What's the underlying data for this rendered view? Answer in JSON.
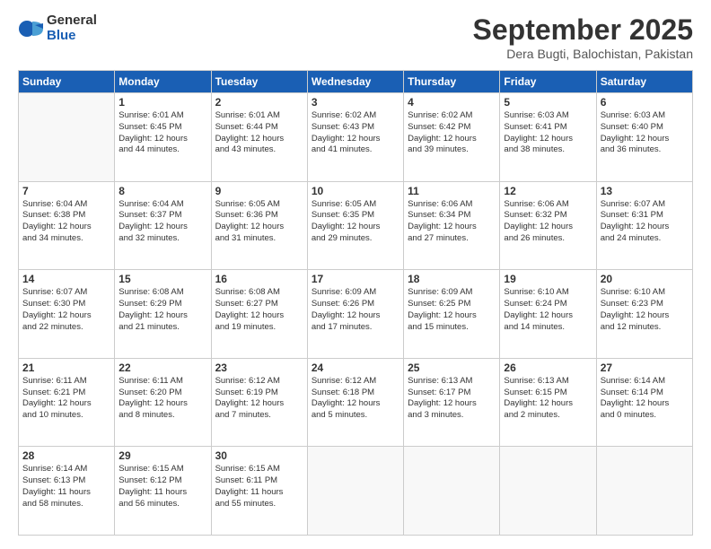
{
  "logo": {
    "general": "General",
    "blue": "Blue"
  },
  "header": {
    "title": "September 2025",
    "location": "Dera Bugti, Balochistan, Pakistan"
  },
  "weekdays": [
    "Sunday",
    "Monday",
    "Tuesday",
    "Wednesday",
    "Thursday",
    "Friday",
    "Saturday"
  ],
  "weeks": [
    [
      {
        "day": "",
        "info": ""
      },
      {
        "day": "1",
        "info": "Sunrise: 6:01 AM\nSunset: 6:45 PM\nDaylight: 12 hours\nand 44 minutes."
      },
      {
        "day": "2",
        "info": "Sunrise: 6:01 AM\nSunset: 6:44 PM\nDaylight: 12 hours\nand 43 minutes."
      },
      {
        "day": "3",
        "info": "Sunrise: 6:02 AM\nSunset: 6:43 PM\nDaylight: 12 hours\nand 41 minutes."
      },
      {
        "day": "4",
        "info": "Sunrise: 6:02 AM\nSunset: 6:42 PM\nDaylight: 12 hours\nand 39 minutes."
      },
      {
        "day": "5",
        "info": "Sunrise: 6:03 AM\nSunset: 6:41 PM\nDaylight: 12 hours\nand 38 minutes."
      },
      {
        "day": "6",
        "info": "Sunrise: 6:03 AM\nSunset: 6:40 PM\nDaylight: 12 hours\nand 36 minutes."
      }
    ],
    [
      {
        "day": "7",
        "info": "Sunrise: 6:04 AM\nSunset: 6:38 PM\nDaylight: 12 hours\nand 34 minutes."
      },
      {
        "day": "8",
        "info": "Sunrise: 6:04 AM\nSunset: 6:37 PM\nDaylight: 12 hours\nand 32 minutes."
      },
      {
        "day": "9",
        "info": "Sunrise: 6:05 AM\nSunset: 6:36 PM\nDaylight: 12 hours\nand 31 minutes."
      },
      {
        "day": "10",
        "info": "Sunrise: 6:05 AM\nSunset: 6:35 PM\nDaylight: 12 hours\nand 29 minutes."
      },
      {
        "day": "11",
        "info": "Sunrise: 6:06 AM\nSunset: 6:34 PM\nDaylight: 12 hours\nand 27 minutes."
      },
      {
        "day": "12",
        "info": "Sunrise: 6:06 AM\nSunset: 6:32 PM\nDaylight: 12 hours\nand 26 minutes."
      },
      {
        "day": "13",
        "info": "Sunrise: 6:07 AM\nSunset: 6:31 PM\nDaylight: 12 hours\nand 24 minutes."
      }
    ],
    [
      {
        "day": "14",
        "info": "Sunrise: 6:07 AM\nSunset: 6:30 PM\nDaylight: 12 hours\nand 22 minutes."
      },
      {
        "day": "15",
        "info": "Sunrise: 6:08 AM\nSunset: 6:29 PM\nDaylight: 12 hours\nand 21 minutes."
      },
      {
        "day": "16",
        "info": "Sunrise: 6:08 AM\nSunset: 6:27 PM\nDaylight: 12 hours\nand 19 minutes."
      },
      {
        "day": "17",
        "info": "Sunrise: 6:09 AM\nSunset: 6:26 PM\nDaylight: 12 hours\nand 17 minutes."
      },
      {
        "day": "18",
        "info": "Sunrise: 6:09 AM\nSunset: 6:25 PM\nDaylight: 12 hours\nand 15 minutes."
      },
      {
        "day": "19",
        "info": "Sunrise: 6:10 AM\nSunset: 6:24 PM\nDaylight: 12 hours\nand 14 minutes."
      },
      {
        "day": "20",
        "info": "Sunrise: 6:10 AM\nSunset: 6:23 PM\nDaylight: 12 hours\nand 12 minutes."
      }
    ],
    [
      {
        "day": "21",
        "info": "Sunrise: 6:11 AM\nSunset: 6:21 PM\nDaylight: 12 hours\nand 10 minutes."
      },
      {
        "day": "22",
        "info": "Sunrise: 6:11 AM\nSunset: 6:20 PM\nDaylight: 12 hours\nand 8 minutes."
      },
      {
        "day": "23",
        "info": "Sunrise: 6:12 AM\nSunset: 6:19 PM\nDaylight: 12 hours\nand 7 minutes."
      },
      {
        "day": "24",
        "info": "Sunrise: 6:12 AM\nSunset: 6:18 PM\nDaylight: 12 hours\nand 5 minutes."
      },
      {
        "day": "25",
        "info": "Sunrise: 6:13 AM\nSunset: 6:17 PM\nDaylight: 12 hours\nand 3 minutes."
      },
      {
        "day": "26",
        "info": "Sunrise: 6:13 AM\nSunset: 6:15 PM\nDaylight: 12 hours\nand 2 minutes."
      },
      {
        "day": "27",
        "info": "Sunrise: 6:14 AM\nSunset: 6:14 PM\nDaylight: 12 hours\nand 0 minutes."
      }
    ],
    [
      {
        "day": "28",
        "info": "Sunrise: 6:14 AM\nSunset: 6:13 PM\nDaylight: 11 hours\nand 58 minutes."
      },
      {
        "day": "29",
        "info": "Sunrise: 6:15 AM\nSunset: 6:12 PM\nDaylight: 11 hours\nand 56 minutes."
      },
      {
        "day": "30",
        "info": "Sunrise: 6:15 AM\nSunset: 6:11 PM\nDaylight: 11 hours\nand 55 minutes."
      },
      {
        "day": "",
        "info": ""
      },
      {
        "day": "",
        "info": ""
      },
      {
        "day": "",
        "info": ""
      },
      {
        "day": "",
        "info": ""
      }
    ]
  ]
}
